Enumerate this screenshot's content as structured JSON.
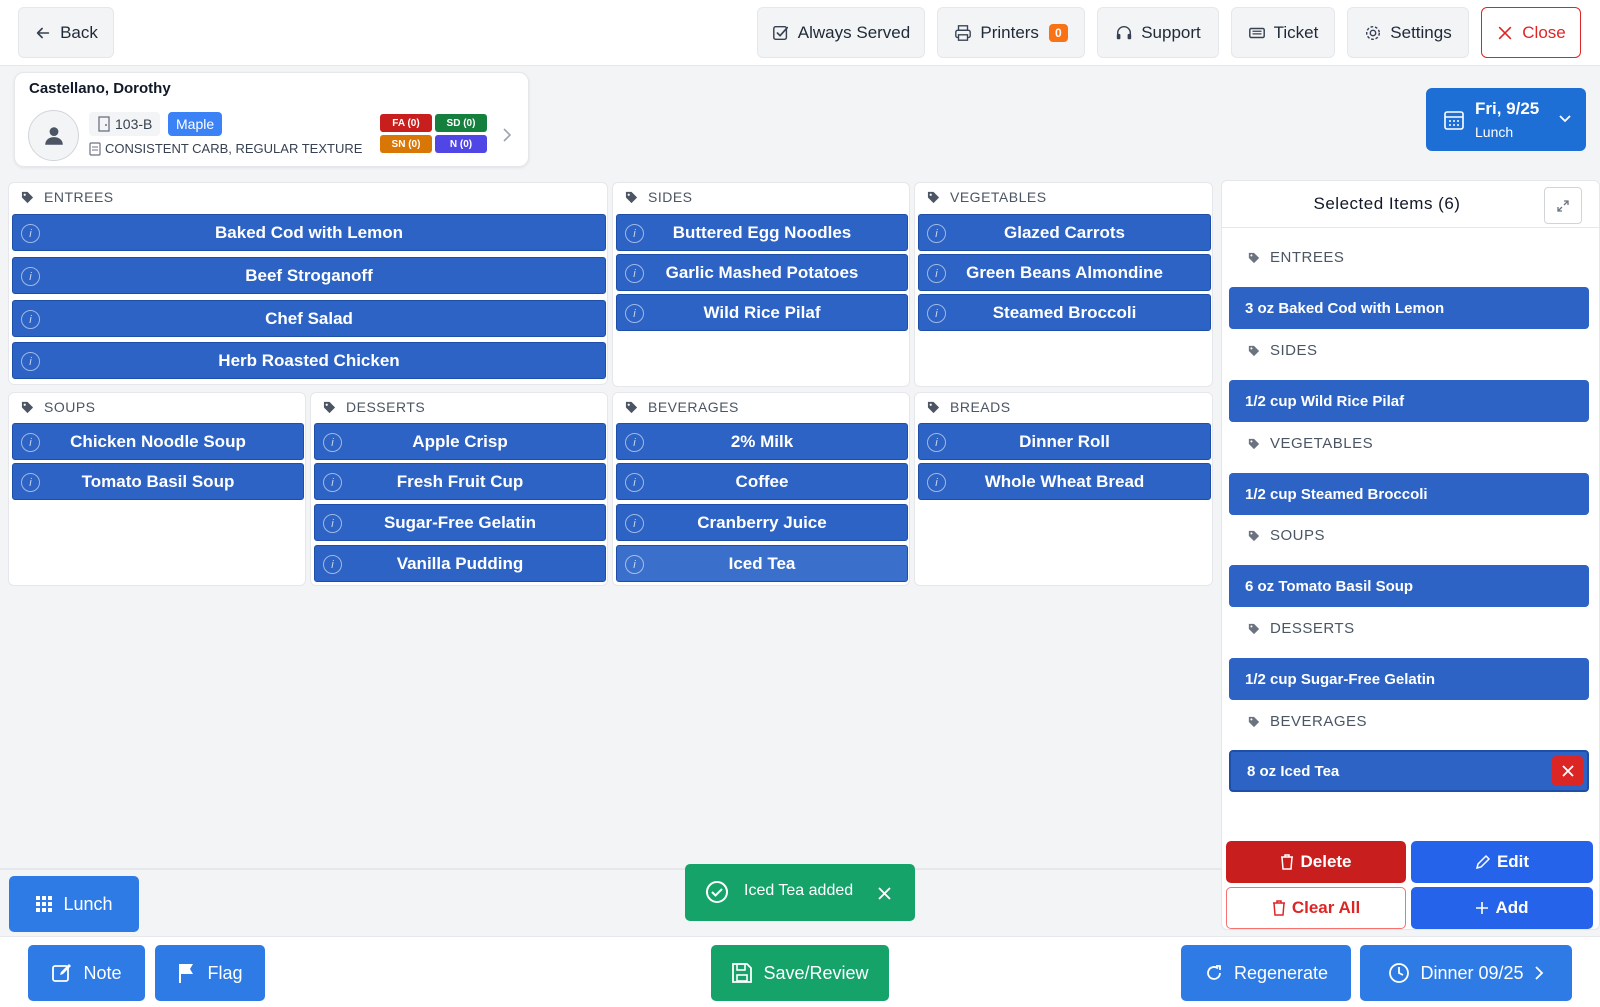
{
  "topbar": {
    "back_label": "Back",
    "always_served_label": "Always Served",
    "printers_label": "Printers",
    "printers_count": "0",
    "support_label": "Support",
    "ticket_label": "Ticket",
    "settings_label": "Settings",
    "close_label": "Close"
  },
  "resident": {
    "name": "Castellano, Dorothy",
    "room": "103-B",
    "unit": "Maple",
    "diet": "CONSISTENT CARB, REGULAR TEXTURE",
    "tags": {
      "fa": "FA (0)",
      "sd": "SD (0)",
      "sn": "SN (0)",
      "n": "N (0)"
    }
  },
  "date": {
    "main": "Fri, 9/25",
    "meal": "Lunch"
  },
  "categories": {
    "entrees": {
      "label": "ENTREES",
      "items": [
        "Baked Cod with Lemon",
        "Beef Stroganoff",
        "Chef Salad",
        "Herb Roasted Chicken"
      ]
    },
    "sides": {
      "label": "SIDES",
      "items": [
        "Buttered Egg Noodles",
        "Garlic Mashed Potatoes",
        "Wild Rice Pilaf"
      ]
    },
    "vegetables": {
      "label": "VEGETABLES",
      "items": [
        "Glazed Carrots",
        "Green Beans Almondine",
        "Steamed Broccoli"
      ]
    },
    "soups": {
      "label": "SOUPS",
      "items": [
        "Chicken Noodle Soup",
        "Tomato Basil Soup"
      ]
    },
    "desserts": {
      "label": "DESSERTS",
      "items": [
        "Apple Crisp",
        "Fresh Fruit Cup",
        "Sugar-Free Gelatin",
        "Vanilla Pudding"
      ]
    },
    "beverages": {
      "label": "BEVERAGES",
      "items": [
        "2% Milk",
        "Coffee",
        "Cranberry Juice",
        "Iced Tea"
      ]
    },
    "breads": {
      "label": "BREADS",
      "items": [
        "Dinner Roll",
        "Whole Wheat Bread"
      ]
    }
  },
  "selected": {
    "title": "Selected Items (6)",
    "groups": [
      {
        "label": "ENTREES",
        "item": "3 oz Baked Cod with Lemon"
      },
      {
        "label": "SIDES",
        "item": "1/2 cup Wild Rice Pilaf"
      },
      {
        "label": "VEGETABLES",
        "item": "1/2 cup Steamed Broccoli"
      },
      {
        "label": "SOUPS",
        "item": "6 oz Tomato Basil Soup"
      },
      {
        "label": "DESSERTS",
        "item": "1/2 cup Sugar-Free Gelatin"
      },
      {
        "label": "BEVERAGES",
        "item": "8 oz Iced Tea"
      }
    ],
    "delete_label": "Delete",
    "edit_label": "Edit",
    "clear_label": "Clear All",
    "add_label": "Add"
  },
  "meal_button": "Lunch",
  "toast": "Iced Tea added",
  "bottom": {
    "note_label": "Note",
    "flag_label": "Flag",
    "save_label": "Save/Review",
    "regenerate_label": "Regenerate",
    "next_meal_label": "Dinner 09/25"
  },
  "colors": {
    "primary": "#2d63c4",
    "accent": "#1d6fd6",
    "danger": "#c81e1e",
    "success": "#16a36a",
    "warning": "#f97316"
  }
}
